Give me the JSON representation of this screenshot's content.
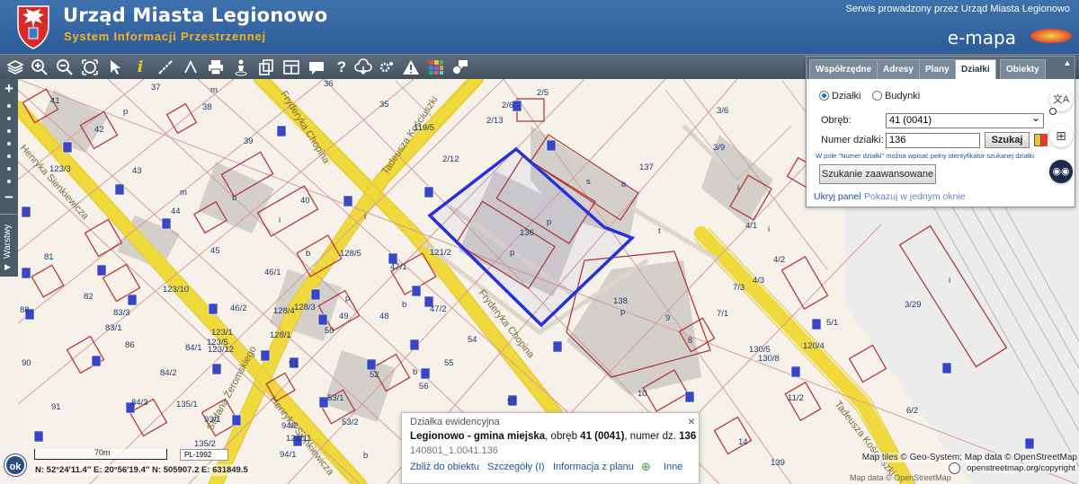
{
  "header": {
    "title": "Urząd Miasta Legionowo",
    "subtitle": "System Informacji Przestrzennej",
    "operator": "Serwis prowadzony przez Urząd Miasta Legionowo",
    "brand": "e-mapa"
  },
  "toolbar": {
    "icons": [
      "layers-icon",
      "zoom-in-icon",
      "zoom-out-icon",
      "zoom-extent-icon",
      "pointer-icon",
      "info-icon",
      "measure-distance-icon",
      "measure-area-icon",
      "print-icon",
      "street-view-icon",
      "clipboard-icon",
      "layout-icon",
      "comment-icon",
      "help-icon",
      "cloud-download-icon",
      "settings-icon",
      "warning-icon",
      "color-grid-icon",
      "chat-icon"
    ]
  },
  "left_bar": {
    "zoom_in": "+",
    "zoom_out": "−",
    "layers_label": "Warstwy"
  },
  "panel": {
    "tabs": [
      "Współrzędne",
      "Adresy",
      "Plany",
      "Działki",
      "Obiekty"
    ],
    "active_tab": "Działki",
    "radio_parcels": "Działki",
    "radio_buildings": "Budynki",
    "label_obreb": "Obręb:",
    "obreb_value": "41 (0041)",
    "label_numer": "Numer działki:",
    "numer_value": "136",
    "search_button": "Szukaj",
    "hint": "W pole \"Numer działki\" można wpisać pełny identyfikator szukanej działki",
    "advanced_button": "Szukanie zaawansowane",
    "hide_panel": "Ukryj panel",
    "show_one_window": "Pokazuj w jednym oknie"
  },
  "popup": {
    "title": "Działka ewidencyjna",
    "main_bold": "Legionowo - gmina miejska",
    "main_rest": ", obręb ",
    "obreb_bold": "41 (0041)",
    "numer_rest": ", numer dz. ",
    "numer_bold": "136",
    "identifier": "140801_1.0041.136",
    "link_zoom": "Zbliż do obiektu",
    "link_details": "Szczegóły (I)",
    "link_plan": "Informacja z planu",
    "link_more": "Inne",
    "close": "×"
  },
  "status": {
    "ok": "ok",
    "scale_label": "70m",
    "crs": "PL-1992",
    "coords": "N: 52°24′11.4″  E: 20°56′19.4″   N: 505907.2   E: 631849.5",
    "attribution": "Map tiles © Geo-System; Map data © OpenStreetMap",
    "attribution_line2": "openstreetmap.org/copyright",
    "attribution_line3": "Map data © OpenStreetMap"
  },
  "map": {
    "streets": [
      "Fryderyka Chopina",
      "Tadeusza Kościuszki",
      "Henryka Sienkiewicza",
      "Stefana Żeromskiego",
      "Henryka Sienkiewicza",
      "Fryderyka Chopina",
      "Tadeusza Kościuszki"
    ],
    "parcel_labels": [
      "37",
      "41",
      "42",
      "43",
      "44",
      "45",
      "38",
      "39",
      "40",
      "35",
      "36",
      "2/5",
      "2/6",
      "2/13",
      "119/5",
      "2/12",
      "137",
      "136",
      "138",
      "3/6",
      "3/9",
      "4/1",
      "4/2",
      "4/3",
      "3/29",
      "7/1",
      "7/3",
      "5/1",
      "120/4",
      "130/5",
      "130/8",
      "11/2",
      "6/2",
      "14",
      "139",
      "1",
      "9",
      "8",
      "10",
      "12",
      "123/3",
      "123/10",
      "123/1",
      "123/5",
      "128/5",
      "121/2",
      "128/3",
      "128/4",
      "128/1",
      "46/1",
      "46/2",
      "47/1",
      "47/2",
      "48",
      "49",
      "50",
      "51",
      "52",
      "53/1",
      "53/2",
      "54",
      "55",
      "56",
      "57",
      "81",
      "82",
      "83/1",
      "83/3",
      "84/1",
      "84/2",
      "84/3",
      "86",
      "88",
      "90",
      "91",
      "93/1",
      "94/1",
      "94/2",
      "135/1",
      "123/11",
      "123/12",
      "135/2"
    ]
  }
}
